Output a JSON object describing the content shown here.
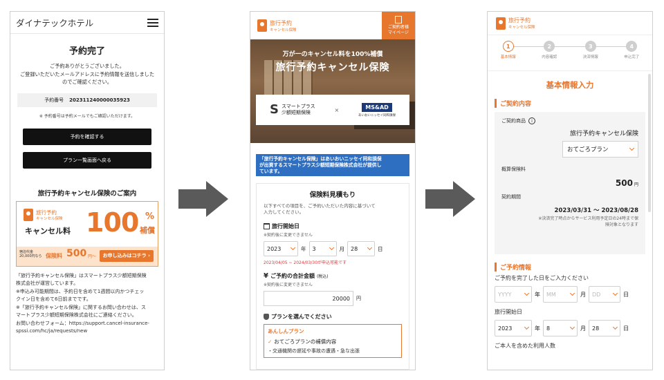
{
  "p1": {
    "hotel_name": "ダイナテックホテル",
    "title": "予約完了",
    "message_l1": "ご予約ありがとうございました。",
    "message_l2": "ご登録いただいたメールアドレスに予約情報を送信しました",
    "message_l3": "のでご確認ください。",
    "resv_label": "予約番号",
    "resv_number": "202311240000035923",
    "resv_note": "※ 予約番号は予約メールでもご確認いただけます。",
    "btn_confirm": "予約を確認する",
    "btn_plans": "プラン一覧画面へ戻る",
    "guide_title": "旅行予約キャンセル保険のご案内",
    "banner": {
      "brand1": "旅行予約",
      "brand2": "キャンセル保険",
      "cancel_fee": "キャンセル料",
      "big_number": "100",
      "percent": "%",
      "hosho": "補償",
      "plan_line1": "宿泊代金",
      "plan_line2": "20,000円なら",
      "insurance_fee_label": "保険料",
      "price": "500",
      "yen": "円〜",
      "cta": "お申し込みはコチラ ›"
    },
    "body_l1": "「旅行予約キャンセル保険」はスマートプラス少額短期保険",
    "body_l2": "株式会社が運営しています。",
    "body_l3": "※申込み可能期間は、予約日を含めて1週間以内かつチェッ",
    "body_l4": "クイン日を含めて6日前までです。",
    "body_l5": "※「旅行予約キャンセル保険」に関するお問い合わせは、ス",
    "body_l6": "マートプラス少額短期保険株式会社にご連絡ください。",
    "body_l7": "お問い合わせフォーム：https://support.cancel-insurance-",
    "body_l8": "spssi.com/hc/ja/requests/new"
  },
  "p2": {
    "brand1": "旅行予約",
    "brand2": "キャンセル保険",
    "mypage_l1": "ご契約者様",
    "mypage_l2": "マイページ",
    "hero_sub": "万が一のキャンセル料を100%補償",
    "hero_title": "旅行予約キャンセル保険",
    "logo_s": "S",
    "logo_l1": "スマートプラス",
    "logo_l2": "少額短期保険",
    "logo_x": "×",
    "msad": "MS&AD",
    "msad_sub": "あいおいニッセイ同和損保",
    "blue_l1": "「旅行予約キャンセル保険」はあいおいニッセイ同和損保",
    "blue_l2": "が出資するスマートプラス少額短期保険株式会社が提供し",
    "blue_l3": "ています。",
    "card_title": "保険料見積もり",
    "card_desc_l1": "以下すべての項目を、ご予約いただいた内容に基づいて",
    "card_desc_l2": "入力してください。",
    "start_title": "旅行開始日",
    "start_note": "※契約後に変更できません",
    "year": "2023",
    "year_unit": "年",
    "month": "3",
    "month_unit": "月",
    "day": "28",
    "day_unit": "日",
    "range": "2023/04/05 ~ 2024/03/30が申込可能です",
    "amount_title": "ご予約の合計金額",
    "amount_tax": "(税込)",
    "amount_note": "※契約後に変更できません",
    "amount": "20000",
    "amount_unit": "円",
    "plan_title": "プランを選んでください",
    "plan_name": "あんしんプラン",
    "plan_check": "おてごろプランの補償内容",
    "plan_cut": "・交通機関の遅延や事故の遭遇・急な出張"
  },
  "p3": {
    "brand1": "旅行予約",
    "brand2": "キャンセル保険",
    "steps": [
      {
        "num": "1",
        "label": "基本情報"
      },
      {
        "num": "2",
        "label": "内容確認"
      },
      {
        "num": "3",
        "label": "決済情報"
      },
      {
        "num": "4",
        "label": "申込完了"
      }
    ],
    "title": "基本情報入力",
    "sec1": "ご契約内容",
    "product_label": "ご契約商品",
    "info_icon": "i",
    "product": "旅行予約キャンセル保険",
    "plan": "おてごろプラン",
    "premium_label": "概算保険料",
    "premium": "500",
    "premium_unit": "円",
    "period_label": "契約期間",
    "period": "2023/03/31 〜 2023/08/28",
    "period_note_l1": "※決済完了時点からサービス利用予定日の24時まで保",
    "period_note_l2": "険対象となります",
    "sec2": "ご予約情報",
    "q_date": "ご予約を完了した日をご入力ください",
    "ph_year": "YYYY",
    "ph_month": "MM",
    "ph_day": "DD",
    "year_unit": "年",
    "month_unit": "月",
    "day_unit": "日",
    "start_label": "旅行開始日",
    "year": "2023",
    "month": "8",
    "day": "28",
    "people_label": "ご本人を含めた利用人数"
  },
  "colors": {
    "accent": "#e8772e",
    "info_blue": "#2f6fc1",
    "warning_red": "#d9383e",
    "arrow": "#5a5a5a"
  }
}
